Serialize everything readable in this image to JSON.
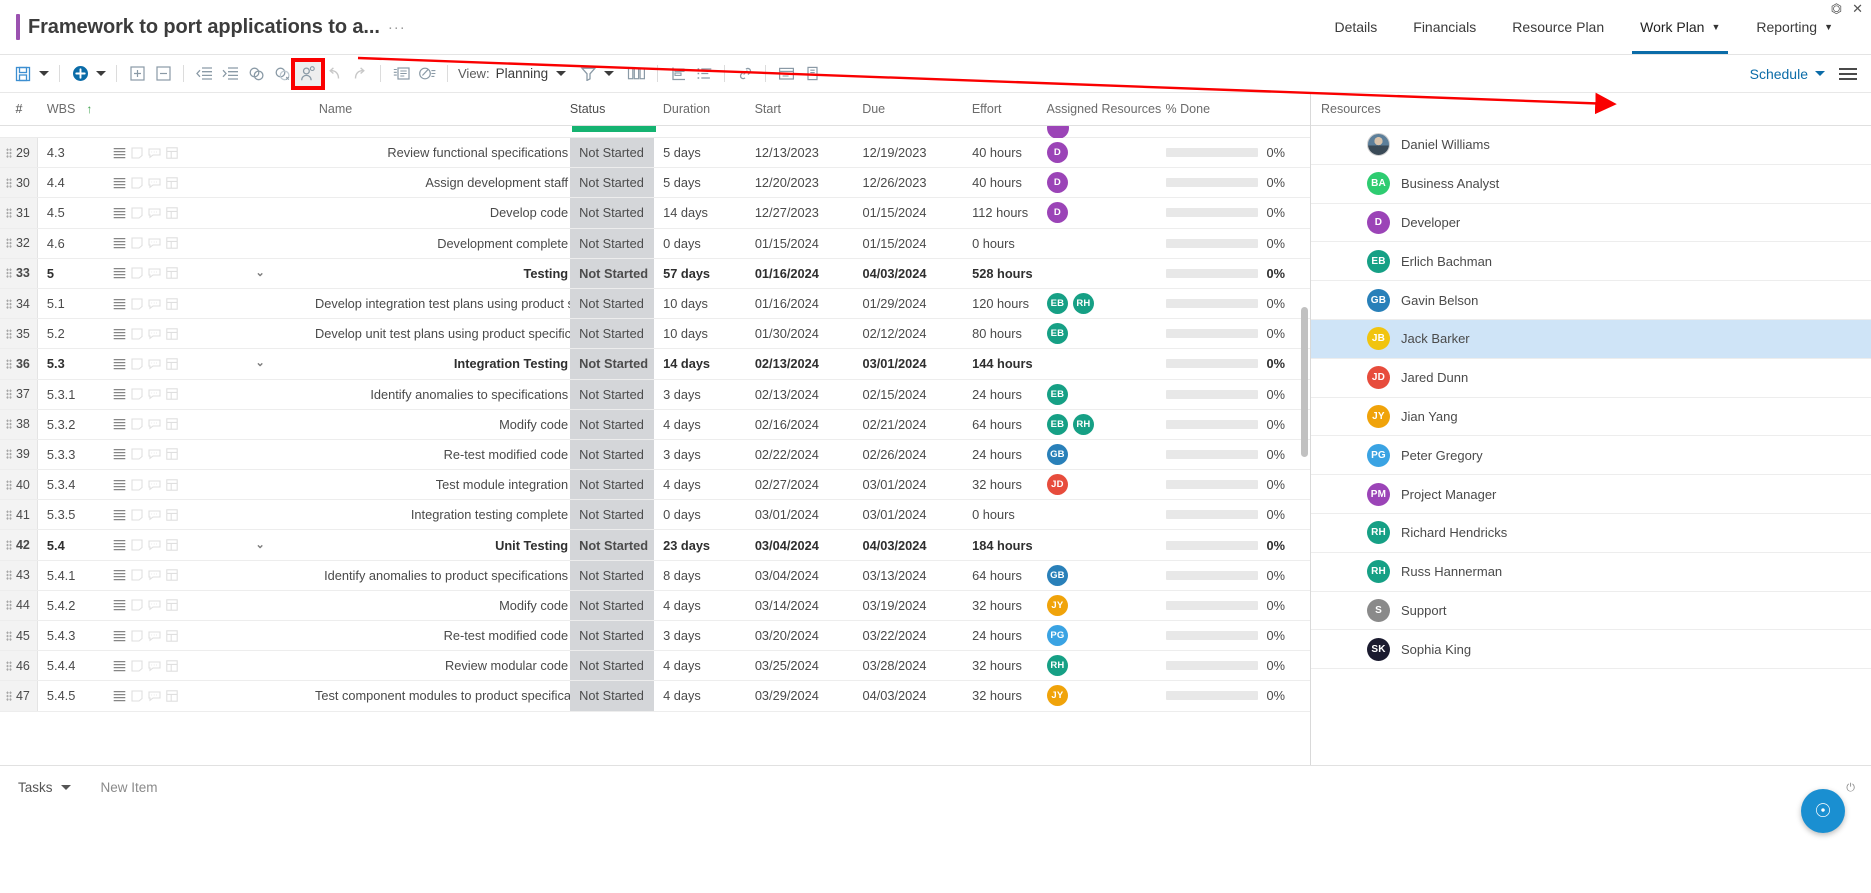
{
  "window": {
    "restore_icon": "restore-icon",
    "close_icon": "close-icon"
  },
  "header": {
    "project_title": "Framework to port applications to a...",
    "title_ellipsis": "···",
    "nav": [
      {
        "label": "Details",
        "has_caret": false,
        "active": false
      },
      {
        "label": "Financials",
        "has_caret": false,
        "active": false
      },
      {
        "label": "Resource Plan",
        "has_caret": false,
        "active": false
      },
      {
        "label": "Work Plan",
        "has_caret": true,
        "active": true
      },
      {
        "label": "Reporting",
        "has_caret": true,
        "active": false
      }
    ]
  },
  "toolbar": {
    "buttons": [
      {
        "name": "save-button",
        "icon": "save-icon"
      },
      {
        "name": "save-dropdown",
        "icon": "chevron-down-icon"
      },
      {
        "name": "add-task-button",
        "icon": "plus-circle-icon"
      },
      {
        "name": "add-task-dropdown",
        "icon": "chevron-down-icon"
      },
      {
        "name": "expand-all-button",
        "icon": "expand-plus-icon"
      },
      {
        "name": "collapse-all-button",
        "icon": "collapse-minus-icon"
      },
      {
        "name": "outdent-button",
        "icon": "outdent-icon"
      },
      {
        "name": "indent-button",
        "icon": "indent-icon"
      },
      {
        "name": "link-tasks-button",
        "icon": "link-icon"
      },
      {
        "name": "unlink-tasks-button",
        "icon": "unlink-icon"
      },
      {
        "name": "assign-resource-button",
        "icon": "person-add-icon"
      },
      {
        "name": "undo-button",
        "icon": "undo-icon"
      },
      {
        "name": "redo-button",
        "icon": "redo-icon"
      },
      {
        "name": "notes-button",
        "icon": "notes-icon"
      },
      {
        "name": "status-button",
        "icon": "check-list-icon"
      }
    ],
    "view_label": "View:",
    "view_value": "Planning",
    "filter_icon": "filter-icon",
    "columns_icon": "columns-icon",
    "baseline_icon": "baseline-icon",
    "outline-icon": "outline-list-icon",
    "dependency_icon": "dependency-link-icon",
    "calendar_icon": "calendar-icon",
    "report_icon": "report-icon",
    "schedule_label": "Schedule",
    "menu_icon": "hamburger-menu-icon"
  },
  "grid": {
    "columns": [
      {
        "key": "num",
        "label": "#"
      },
      {
        "key": "wbs",
        "label": "WBS",
        "sort": "↑"
      },
      {
        "key": "name",
        "label": "Name"
      },
      {
        "key": "status",
        "label": "Status"
      },
      {
        "key": "duration",
        "label": "Duration"
      },
      {
        "key": "start",
        "label": "Start"
      },
      {
        "key": "due",
        "label": "Due"
      },
      {
        "key": "effort",
        "label": "Effort"
      },
      {
        "key": "resources",
        "label": "Assigned Resources"
      },
      {
        "key": "done",
        "label": "% Done"
      }
    ],
    "rows": [
      {
        "num": "29",
        "wbs": "4.3",
        "name": "Review functional specifications",
        "status": "Not Started",
        "duration": "5 days",
        "start": "12/13/2023",
        "due": "12/19/2023",
        "effort": "40 hours",
        "done": "0%",
        "summary": false,
        "expander": false,
        "res": [
          {
            "initials": "D",
            "color": "#9b44b7"
          }
        ]
      },
      {
        "num": "30",
        "wbs": "4.4",
        "name": "Assign development staff",
        "status": "Not Started",
        "duration": "5 days",
        "start": "12/20/2023",
        "due": "12/26/2023",
        "effort": "40 hours",
        "done": "0%",
        "summary": false,
        "expander": false,
        "res": [
          {
            "initials": "D",
            "color": "#9b44b7"
          }
        ]
      },
      {
        "num": "31",
        "wbs": "4.5",
        "name": "Develop code",
        "status": "Not Started",
        "duration": "14 days",
        "start": "12/27/2023",
        "due": "01/15/2024",
        "effort": "112 hours",
        "done": "0%",
        "summary": false,
        "expander": false,
        "res": [
          {
            "initials": "D",
            "color": "#9b44b7"
          }
        ]
      },
      {
        "num": "32",
        "wbs": "4.6",
        "name": "Development complete",
        "status": "Not Started",
        "duration": "0 days",
        "start": "01/15/2024",
        "due": "01/15/2024",
        "effort": "0 hours",
        "done": "0%",
        "summary": false,
        "expander": false,
        "res": []
      },
      {
        "num": "33",
        "wbs": "5",
        "name": "Testing",
        "status": "Not Started",
        "duration": "57 days",
        "start": "01/16/2024",
        "due": "04/03/2024",
        "effort": "528 hours",
        "done": "0%",
        "summary": true,
        "expander": true,
        "res": []
      },
      {
        "num": "34",
        "wbs": "5.1",
        "name": "Develop integration test plans using product specifica",
        "status": "Not Started",
        "duration": "10 days",
        "start": "01/16/2024",
        "due": "01/29/2024",
        "effort": "120 hours",
        "done": "0%",
        "summary": false,
        "expander": false,
        "res": [
          {
            "initials": "EB",
            "color": "#16a085"
          },
          {
            "initials": "RH",
            "color": "#16a085"
          }
        ]
      },
      {
        "num": "35",
        "wbs": "5.2",
        "name": "Develop unit test plans using product specifications",
        "status": "Not Started",
        "duration": "10 days",
        "start": "01/30/2024",
        "due": "02/12/2024",
        "effort": "80 hours",
        "done": "0%",
        "summary": false,
        "expander": false,
        "res": [
          {
            "initials": "EB",
            "color": "#16a085"
          }
        ]
      },
      {
        "num": "36",
        "wbs": "5.3",
        "name": "Integration Testing",
        "status": "Not Started",
        "duration": "14 days",
        "start": "02/13/2024",
        "due": "03/01/2024",
        "effort": "144 hours",
        "done": "0%",
        "summary": true,
        "expander": true,
        "res": []
      },
      {
        "num": "37",
        "wbs": "5.3.1",
        "name": "Identify anomalies to specifications",
        "status": "Not Started",
        "duration": "3 days",
        "start": "02/13/2024",
        "due": "02/15/2024",
        "effort": "24 hours",
        "done": "0%",
        "summary": false,
        "expander": false,
        "res": [
          {
            "initials": "EB",
            "color": "#16a085"
          }
        ]
      },
      {
        "num": "38",
        "wbs": "5.3.2",
        "name": "Modify code",
        "status": "Not Started",
        "duration": "4 days",
        "start": "02/16/2024",
        "due": "02/21/2024",
        "effort": "64 hours",
        "done": "0%",
        "summary": false,
        "expander": false,
        "res": [
          {
            "initials": "EB",
            "color": "#16a085"
          },
          {
            "initials": "RH",
            "color": "#16a085"
          }
        ]
      },
      {
        "num": "39",
        "wbs": "5.3.3",
        "name": "Re-test modified code",
        "status": "Not Started",
        "duration": "3 days",
        "start": "02/22/2024",
        "due": "02/26/2024",
        "effort": "24 hours",
        "done": "0%",
        "summary": false,
        "expander": false,
        "res": [
          {
            "initials": "GB",
            "color": "#2980b9"
          }
        ]
      },
      {
        "num": "40",
        "wbs": "5.3.4",
        "name": "Test module integration",
        "status": "Not Started",
        "duration": "4 days",
        "start": "02/27/2024",
        "due": "03/01/2024",
        "effort": "32 hours",
        "done": "0%",
        "summary": false,
        "expander": false,
        "res": [
          {
            "initials": "JD",
            "color": "#e74c3c"
          }
        ]
      },
      {
        "num": "41",
        "wbs": "5.3.5",
        "name": "Integration testing complete",
        "status": "Not Started",
        "duration": "0 days",
        "start": "03/01/2024",
        "due": "03/01/2024",
        "effort": "0 hours",
        "done": "0%",
        "summary": false,
        "expander": false,
        "res": []
      },
      {
        "num": "42",
        "wbs": "5.4",
        "name": "Unit Testing",
        "status": "Not Started",
        "duration": "23 days",
        "start": "03/04/2024",
        "due": "04/03/2024",
        "effort": "184 hours",
        "done": "0%",
        "summary": true,
        "expander": true,
        "res": []
      },
      {
        "num": "43",
        "wbs": "5.4.1",
        "name": "Identify anomalies to product specifications",
        "status": "Not Started",
        "duration": "8 days",
        "start": "03/04/2024",
        "due": "03/13/2024",
        "effort": "64 hours",
        "done": "0%",
        "summary": false,
        "expander": false,
        "res": [
          {
            "initials": "GB",
            "color": "#2980b9"
          }
        ]
      },
      {
        "num": "44",
        "wbs": "5.4.2",
        "name": "Modify code",
        "status": "Not Started",
        "duration": "4 days",
        "start": "03/14/2024",
        "due": "03/19/2024",
        "effort": "32 hours",
        "done": "0%",
        "summary": false,
        "expander": false,
        "res": [
          {
            "initials": "JY",
            "color": "#f0a30a"
          }
        ]
      },
      {
        "num": "45",
        "wbs": "5.4.3",
        "name": "Re-test modified code",
        "status": "Not Started",
        "duration": "3 days",
        "start": "03/20/2024",
        "due": "03/22/2024",
        "effort": "24 hours",
        "done": "0%",
        "summary": false,
        "expander": false,
        "res": [
          {
            "initials": "PG",
            "color": "#3aa3e3"
          }
        ]
      },
      {
        "num": "46",
        "wbs": "5.4.4",
        "name": "Review modular code",
        "status": "Not Started",
        "duration": "4 days",
        "start": "03/25/2024",
        "due": "03/28/2024",
        "effort": "32 hours",
        "done": "0%",
        "summary": false,
        "expander": false,
        "res": [
          {
            "initials": "RH",
            "color": "#16a085"
          }
        ]
      },
      {
        "num": "47",
        "wbs": "5.4.5",
        "name": "Test component modules to product specification",
        "status": "Not Started",
        "duration": "4 days",
        "start": "03/29/2024",
        "due": "04/03/2024",
        "effort": "32 hours",
        "done": "0%",
        "summary": false,
        "expander": false,
        "res": [
          {
            "initials": "JY",
            "color": "#f0a30a"
          }
        ]
      }
    ]
  },
  "resources": {
    "header": "Resources",
    "items": [
      {
        "name": "Daniel Williams",
        "initials": "DW",
        "color": "#6b8ea5",
        "photo": true,
        "selected": false
      },
      {
        "name": "Business Analyst",
        "initials": "BA",
        "color": "#2ecc71",
        "photo": false,
        "selected": false
      },
      {
        "name": "Developer",
        "initials": "D",
        "color": "#9b44b7",
        "photo": false,
        "selected": false
      },
      {
        "name": "Erlich Bachman",
        "initials": "EB",
        "color": "#16a085",
        "photo": false,
        "selected": false
      },
      {
        "name": "Gavin Belson",
        "initials": "GB",
        "color": "#2980b9",
        "photo": false,
        "selected": false
      },
      {
        "name": "Jack Barker",
        "initials": "JB",
        "color": "#f1c40f",
        "photo": false,
        "selected": true
      },
      {
        "name": "Jared Dunn",
        "initials": "JD",
        "color": "#e74c3c",
        "photo": false,
        "selected": false
      },
      {
        "name": "Jian Yang",
        "initials": "JY",
        "color": "#f0a30a",
        "photo": false,
        "selected": false
      },
      {
        "name": "Peter Gregory",
        "initials": "PG",
        "color": "#3aa3e3",
        "photo": false,
        "selected": false
      },
      {
        "name": "Project Manager",
        "initials": "PM",
        "color": "#9b44b7",
        "photo": false,
        "selected": false
      },
      {
        "name": "Richard Hendricks",
        "initials": "RH",
        "color": "#16a085",
        "photo": false,
        "selected": false
      },
      {
        "name": "Russ Hannerman",
        "initials": "RH",
        "color": "#16a085",
        "photo": false,
        "selected": false
      },
      {
        "name": "Support",
        "initials": "S",
        "color": "#8a8a8a",
        "photo": false,
        "selected": false
      },
      {
        "name": "Sophia King",
        "initials": "SK",
        "color": "#1b1b2f",
        "photo": false,
        "selected": false
      }
    ]
  },
  "footer": {
    "tasks_label": "Tasks",
    "new_item_label": "New Item"
  },
  "help": {
    "fab_icon": "help-bubble-icon",
    "power_icon": "power-icon"
  },
  "colors": {
    "accent": "#0b6ca8",
    "title_accent": "#9b52b0",
    "highlight": "#fa0000",
    "status_bg": "#d4d6d9",
    "selected_row": "#cfe4f7"
  }
}
